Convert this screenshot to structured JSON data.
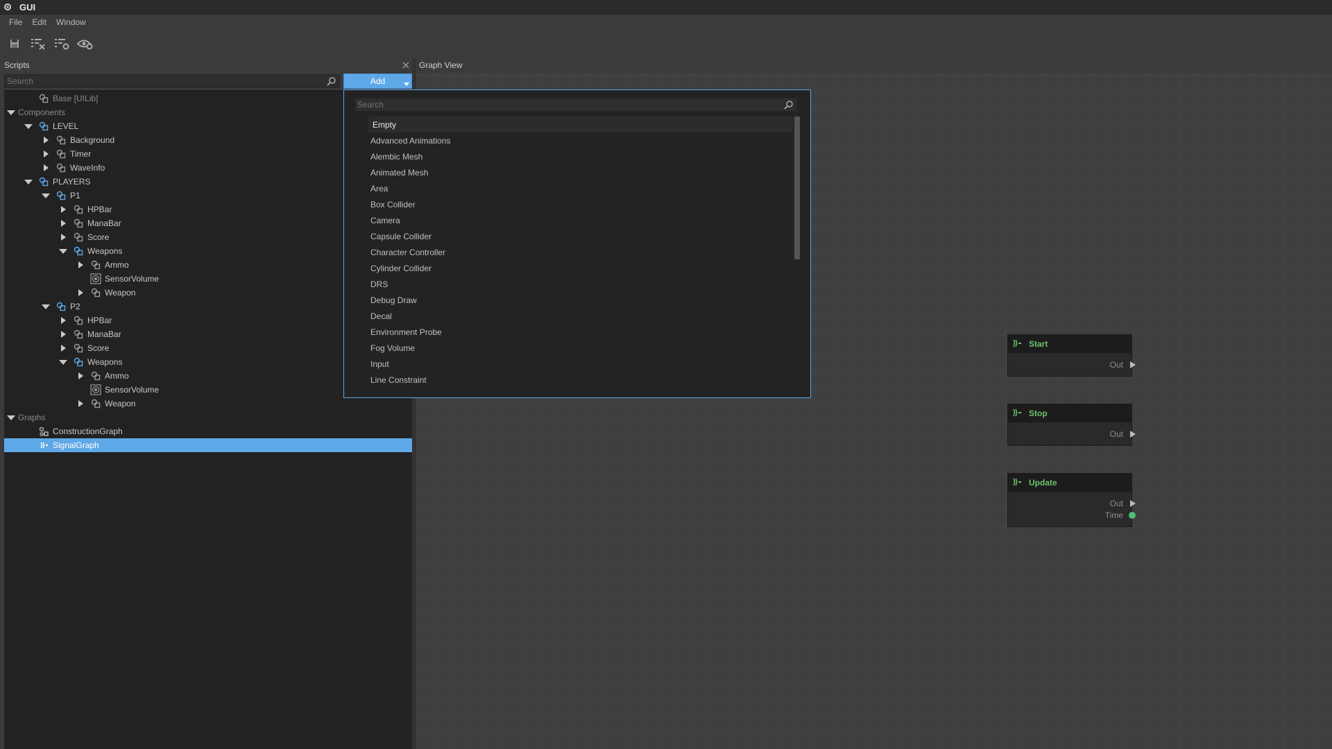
{
  "window": {
    "title": "GUI"
  },
  "menu": [
    "File",
    "Edit",
    "Window"
  ],
  "toolbar": [
    {
      "icon": "save-icon"
    },
    {
      "icon": "deselect-list-icon"
    },
    {
      "icon": "list-settings-icon"
    },
    {
      "icon": "eye-settings-icon"
    }
  ],
  "scripts": {
    "title": "Scripts",
    "search_placeholder": "Search",
    "add_label": "Add",
    "tree": [
      {
        "label": "Base [UILib]",
        "depth": 1,
        "expand": "none",
        "icon": "component-icon",
        "dim": true
      },
      {
        "label": "Components",
        "depth": 0,
        "expand": "open",
        "icon": "none",
        "dim": true
      },
      {
        "label": "LEVEL",
        "depth": 1,
        "expand": "open",
        "icon": "component-blue-icon"
      },
      {
        "label": "Background",
        "depth": 2,
        "expand": "closed",
        "icon": "component-icon"
      },
      {
        "label": "Timer",
        "depth": 2,
        "expand": "closed",
        "icon": "component-icon"
      },
      {
        "label": "WaveInfo",
        "depth": 2,
        "expand": "closed",
        "icon": "component-icon"
      },
      {
        "label": "PLAYERS",
        "depth": 1,
        "expand": "open",
        "icon": "component-blue-icon"
      },
      {
        "label": "P1",
        "depth": 2,
        "expand": "open",
        "icon": "component-blue-icon"
      },
      {
        "label": "HPBar",
        "depth": 3,
        "expand": "closed",
        "icon": "component-icon"
      },
      {
        "label": "ManaBar",
        "depth": 3,
        "expand": "closed",
        "icon": "component-icon"
      },
      {
        "label": "Score",
        "depth": 3,
        "expand": "closed",
        "icon": "component-icon"
      },
      {
        "label": "Weapons",
        "depth": 3,
        "expand": "open",
        "icon": "component-blue-icon"
      },
      {
        "label": "Ammo",
        "depth": 4,
        "expand": "closed",
        "icon": "component-icon"
      },
      {
        "label": "SensorVolume",
        "depth": 4,
        "expand": "none",
        "icon": "sensor-icon"
      },
      {
        "label": "Weapon",
        "depth": 4,
        "expand": "closed",
        "icon": "component-icon"
      },
      {
        "label": "P2",
        "depth": 2,
        "expand": "open",
        "icon": "component-blue-icon"
      },
      {
        "label": "HPBar",
        "depth": 3,
        "expand": "closed",
        "icon": "component-icon"
      },
      {
        "label": "ManaBar",
        "depth": 3,
        "expand": "closed",
        "icon": "component-icon"
      },
      {
        "label": "Score",
        "depth": 3,
        "expand": "closed",
        "icon": "component-icon"
      },
      {
        "label": "Weapons",
        "depth": 3,
        "expand": "open",
        "icon": "component-blue-icon"
      },
      {
        "label": "Ammo",
        "depth": 4,
        "expand": "closed",
        "icon": "component-icon"
      },
      {
        "label": "SensorVolume",
        "depth": 4,
        "expand": "none",
        "icon": "sensor-icon"
      },
      {
        "label": "Weapon",
        "depth": 4,
        "expand": "closed",
        "icon": "component-icon"
      },
      {
        "label": "Graphs",
        "depth": 0,
        "expand": "open",
        "icon": "none",
        "dim": true
      },
      {
        "label": "ConstructionGraph",
        "depth": 1,
        "expand": "none",
        "icon": "construction-graph-icon"
      },
      {
        "label": "SignalGraph",
        "depth": 1,
        "expand": "none",
        "icon": "signal-graph-icon",
        "selected": true
      }
    ]
  },
  "graph": {
    "title": "Graph View",
    "nodes": [
      {
        "name": "Start",
        "ports": [
          {
            "label": "Out",
            "kind": "exec"
          }
        ]
      },
      {
        "name": "Stop",
        "ports": [
          {
            "label": "Out",
            "kind": "exec"
          }
        ]
      },
      {
        "name": "Update",
        "ports": [
          {
            "label": "Out",
            "kind": "exec"
          },
          {
            "label": "Time",
            "kind": "value"
          }
        ]
      }
    ]
  },
  "add_popup": {
    "search_placeholder": "Search",
    "items": [
      "Empty",
      "Advanced Animations",
      "Alembic Mesh",
      "Animated Mesh",
      "Area",
      "Box Collider",
      "Camera",
      "Capsule Collider",
      "Character Controller",
      "Cylinder Collider",
      "DRS",
      "Debug Draw",
      "Decal",
      "Environment Probe",
      "Fog Volume",
      "Input",
      "Line Constraint"
    ],
    "highlighted": "Empty"
  },
  "colors": {
    "accent": "#5ea8e8",
    "node_title": "#6ec26e",
    "value_pin": "#4fbf7a"
  }
}
